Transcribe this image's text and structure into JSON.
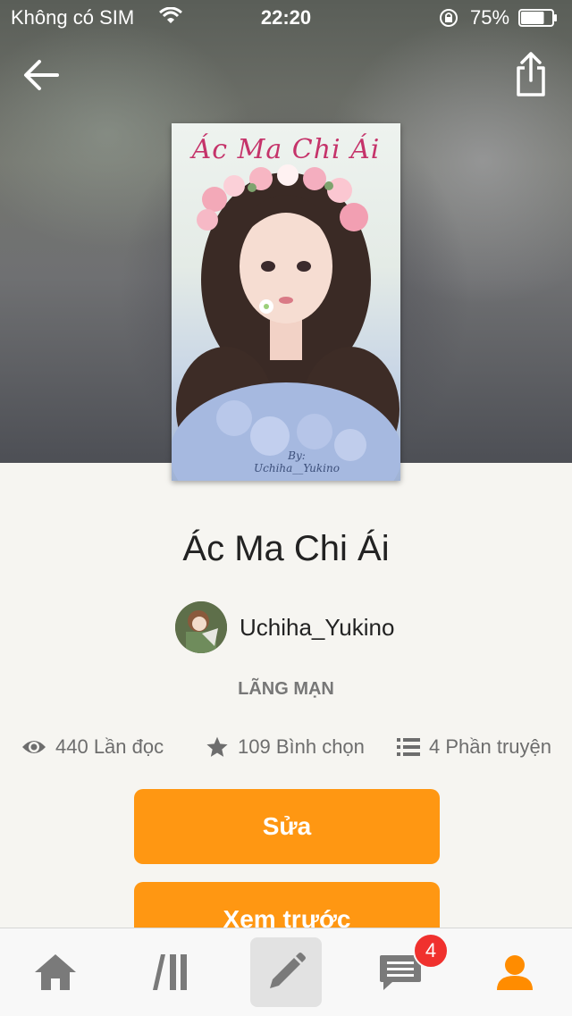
{
  "status_bar": {
    "carrier": "Không có SIM",
    "time": "22:20",
    "battery_percent": "75%",
    "battery_level": 0.75
  },
  "header": {
    "back_icon": "arrow-left-icon",
    "share_icon": "share-icon"
  },
  "book": {
    "cover_title": "Ác Ma Chi Ái",
    "cover_byline_1": "By:",
    "cover_byline_2": "Uchiha__Yukino",
    "title": "Ác Ma Chi Ái",
    "author": "Uchiha_Yukino",
    "genre": "LÃNG MẠN"
  },
  "stats": {
    "reads": "440 Lần đọc",
    "votes": "109 Bình chọn",
    "parts": "4 Phần truyện"
  },
  "actions": {
    "edit_label": "Sửa",
    "preview_label": "Xem trước"
  },
  "tab_bar": {
    "items": [
      "home-icon",
      "library-icon",
      "pencil-icon",
      "messages-icon",
      "profile-icon"
    ],
    "messages_badge": "4",
    "active_color": "#ff8c00",
    "accent_color": "#ff9712"
  }
}
